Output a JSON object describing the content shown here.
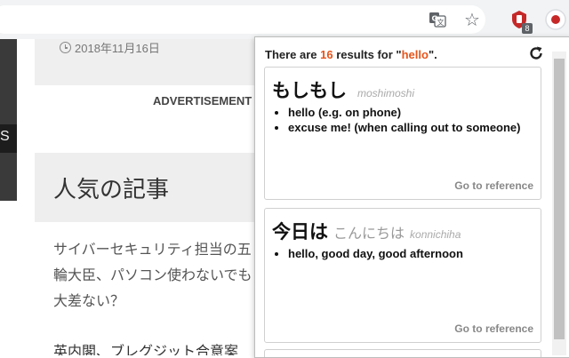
{
  "page": {
    "date": "2018年11月16日",
    "ad_label": "ADVERTISEMENT",
    "thumb_text": "S",
    "popular_title": "人気の記事",
    "article_text": "サイバーセキュリティ担当の五輪大臣、パソコン使わないでも大差ない？",
    "article2_text": "英内閣、ブレグジット合意案"
  },
  "extension": {
    "badge": "8"
  },
  "popup": {
    "head_prefix": "There are ",
    "count": "16",
    "head_mid": " results for \"",
    "query": "hello",
    "head_suffix": "\".",
    "results": [
      {
        "word": "もしもし",
        "reading": "",
        "romaji": "moshimoshi",
        "definitions": [
          "hello (e.g. on phone)",
          "excuse me! (when calling out to someone)"
        ],
        "ref_label": "Go to reference"
      },
      {
        "word": "今日は",
        "reading": "こんにちは",
        "romaji": "konnichiha",
        "definitions": [
          "hello, good day, good afternoon"
        ],
        "ref_label": "Go to reference"
      }
    ]
  },
  "colors": {
    "highlight": "#e8541a",
    "toolbar": "#f1f3f4"
  }
}
